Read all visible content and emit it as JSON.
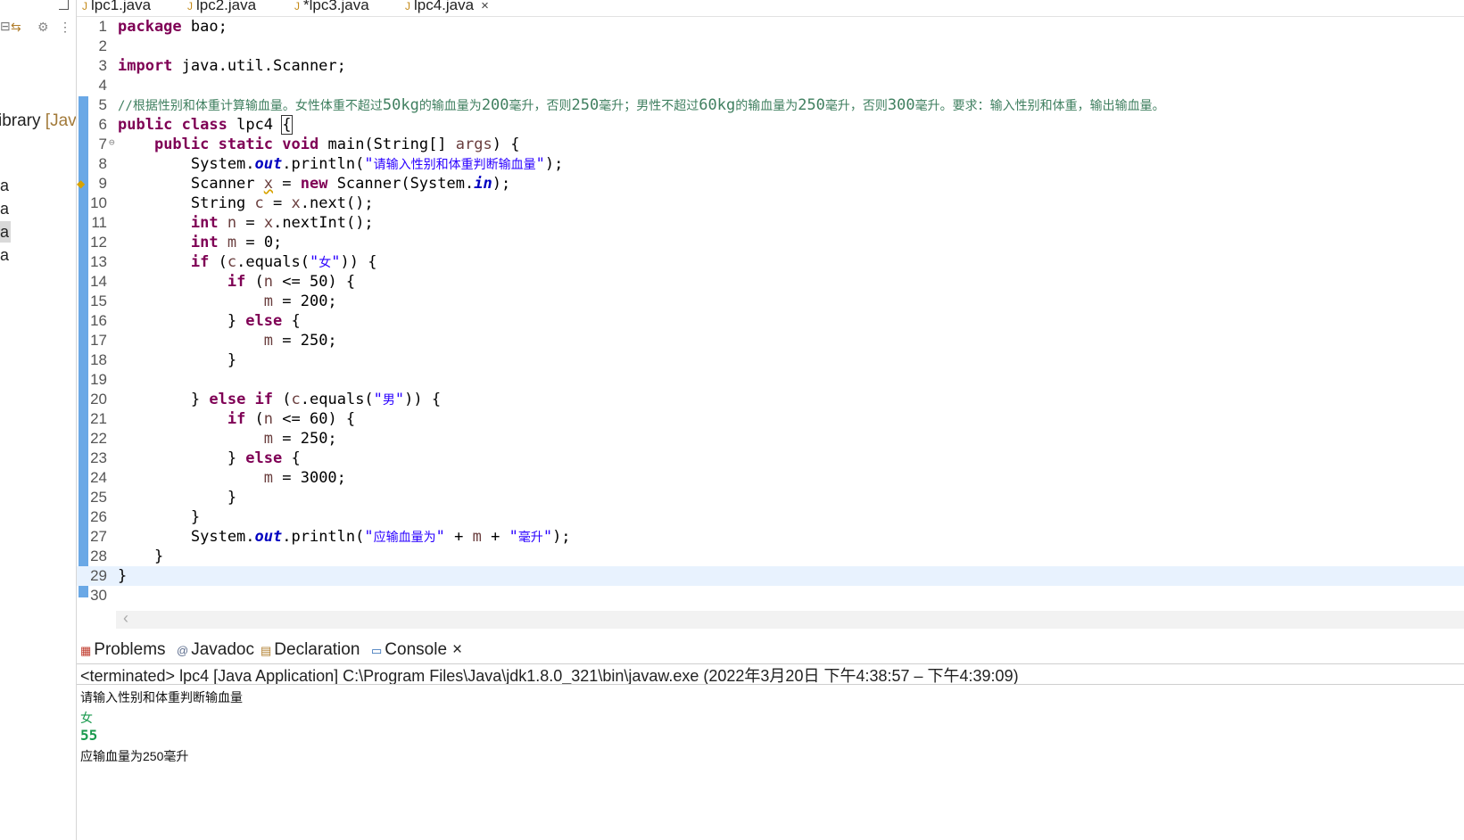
{
  "left_panel": {
    "library_label": "ibrary",
    "library_suffix": "[Jav",
    "items": [
      "a",
      "a",
      "a",
      "a"
    ]
  },
  "editor_tabs": [
    {
      "label": "lpc1.java"
    },
    {
      "label": "lpc2.java"
    },
    {
      "label": "*lpc3.java"
    },
    {
      "label": "lpc4.java",
      "close": "×"
    }
  ],
  "code": {
    "lines": [
      "package bao;",
      "",
      "import java.util.Scanner;",
      "",
      "//根据性别和体重计算输血量。女性体重不超过50kg的输血量为200毫升，否则250毫升；男性不超过60kg的输血量为250毫升，否则300毫升。要求：输入性别和体重，输出输血量。",
      "public class lpc4 {",
      "    public static void main(String[] args) {",
      "        System.out.println(\"请输入性别和体重判断输血量\");",
      "        Scanner x = new Scanner(System.in);",
      "        String c = x.next();",
      "        int n = x.nextInt();",
      "        int m = 0;",
      "        if (c.equals(\"女\")) {",
      "            if (n <= 50) {",
      "                m = 200;",
      "            } else {",
      "                m = 250;",
      "            }",
      "",
      "        } else if (c.equals(\"男\")) {",
      "            if (n <= 60) {",
      "                m = 250;",
      "            } else {",
      "                m = 3000;",
      "            }",
      "        }",
      "        System.out.println(\"应输血量为\" + m + \"毫升\");",
      "    }",
      "}",
      ""
    ]
  },
  "bottom_tabs": [
    {
      "label": "Problems",
      "icon": "problems-icon"
    },
    {
      "label": "Javadoc",
      "icon": "javadoc-icon"
    },
    {
      "label": "Declaration",
      "icon": "declaration-icon"
    },
    {
      "label": "Console",
      "icon": "console-icon",
      "close": "×"
    }
  ],
  "console": {
    "status": "<terminated> lpc4 [Java Application] C:\\Program Files\\Java\\jdk1.8.0_321\\bin\\javaw.exe  (2022年3月20日 下午4:38:57 – 下午4:39:09)",
    "output": [
      {
        "text": "请输入性别和体重判断输血量",
        "kind": "res"
      },
      {
        "text": "女",
        "kind": "in"
      },
      {
        "text": "55",
        "kind": "num"
      },
      {
        "text": "应输血量为250毫升",
        "kind": "res"
      }
    ]
  },
  "colors": {
    "keyword": "#7f0055",
    "string": "#2a00ff",
    "comment": "#3f7f5f",
    "field": "#0000c0",
    "variable": "#6a3e3e",
    "ruler": "#6aa8e6",
    "current_line": "#e8f2fe",
    "console_input": "#1a9a4e"
  }
}
